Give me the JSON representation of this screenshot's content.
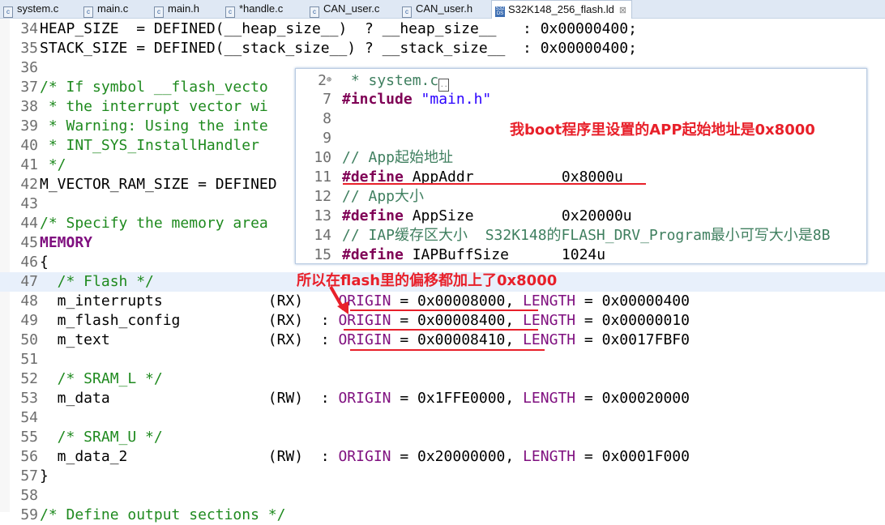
{
  "tabs": [
    {
      "label": "system.c",
      "icon": "c-file-icon",
      "active": false
    },
    {
      "label": "main.c",
      "icon": "c-file-icon",
      "active": false
    },
    {
      "label": "main.h",
      "icon": "c-file-icon",
      "active": false
    },
    {
      "label": "*handle.c",
      "icon": "c-file-icon",
      "active": false
    },
    {
      "label": "CAN_user.c",
      "icon": "c-file-icon",
      "active": false
    },
    {
      "label": "CAN_user.h",
      "icon": "c-file-icon",
      "active": false
    },
    {
      "label": "S32K148_256_flash.ld",
      "icon": "s32ds-file-icon",
      "active": true,
      "close": "⊠"
    }
  ],
  "editor": {
    "lines": [
      {
        "n": "34",
        "code": "HEAP_SIZE  = DEFINED(__heap_size__)  ? __heap_size__   : 0x00000400;"
      },
      {
        "n": "35",
        "code": "STACK_SIZE = DEFINED(__stack_size__) ? __stack_size__  : 0x00000400;"
      },
      {
        "n": "36",
        "code": ""
      },
      {
        "n": "37",
        "code": "/* If symbol __flash_vecto"
      },
      {
        "n": "38",
        "code": " * the interrupt vector wi"
      },
      {
        "n": "39",
        "code": " * Warning: Using the inte"
      },
      {
        "n": "40",
        "code": " * INT_SYS_InstallHandler "
      },
      {
        "n": "41",
        "code": " */"
      },
      {
        "n": "42",
        "code": "M_VECTOR_RAM_SIZE = DEFINED"
      },
      {
        "n": "43",
        "code": ""
      },
      {
        "n": "44",
        "code": "/* Specify the memory area"
      },
      {
        "n": "45",
        "code": "MEMORY"
      },
      {
        "n": "46",
        "code": "{"
      },
      {
        "n": "47",
        "code": "  /* Flash */"
      },
      {
        "n": "48",
        "name": "m_interrupts",
        "attr": "(RX)",
        "colon": " ",
        "origin": "0x00008000",
        "length": "0x00000400"
      },
      {
        "n": "49",
        "name": "m_flash_config",
        "attr": "(RX)",
        "colon": ":",
        "origin": "0x00008400",
        "length": "0x00000010"
      },
      {
        "n": "50",
        "name": "m_text",
        "attr": "(RX)",
        "colon": ":",
        "origin": "0x00008410",
        "length": "0x0017FBF0"
      },
      {
        "n": "51",
        "code": ""
      },
      {
        "n": "52",
        "code": "  /* SRAM_L */"
      },
      {
        "n": "53",
        "name": "m_data",
        "attr": "(RW)",
        "colon": ":",
        "origin": "0x1FFE0000",
        "length": "0x00020000"
      },
      {
        "n": "54",
        "code": ""
      },
      {
        "n": "55",
        "code": "  /* SRAM_U */"
      },
      {
        "n": "56",
        "name": "m_data_2",
        "attr": "(RW)",
        "colon": ":",
        "origin": "0x20000000",
        "length": "0x0001F000"
      },
      {
        "n": "57",
        "code": "}"
      },
      {
        "n": "58",
        "code": ""
      },
      {
        "n": "59",
        "code": "/* Define output sections */"
      }
    ],
    "keywords": {
      "origin": "ORIGIN",
      "length": "LENGTH",
      "memory": "MEMORY"
    }
  },
  "popup": {
    "lines": [
      {
        "n": "2",
        "code": " * system.c",
        "folded": true
      },
      {
        "n": "7",
        "kw": "#include",
        "rest": " ",
        "str": "\"main.h\""
      },
      {
        "n": "8",
        "code": ""
      },
      {
        "n": "9",
        "code": ""
      },
      {
        "n": "10",
        "cm": "// App起始地址"
      },
      {
        "n": "11",
        "kw": "#define",
        "rest": " AppAddr          0x8000u"
      },
      {
        "n": "12",
        "cm": "// App大小"
      },
      {
        "n": "13",
        "kw": "#define",
        "rest": " AppSize          0x20000u"
      },
      {
        "n": "14",
        "cm": "// IAP缓存区大小  S32K148的FLASH_DRV_Program最小可写大小是8B"
      },
      {
        "n": "15",
        "kw": "#define",
        "rest": " IAPBuffSize      1024u"
      }
    ]
  },
  "annotations": {
    "note1": "我boot程序里设置的APP起始地址是0x8000",
    "note2": "所以在flash里的偏移都加上了0x8000",
    "color": "#e8202a"
  }
}
